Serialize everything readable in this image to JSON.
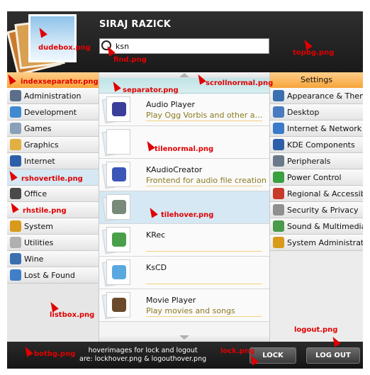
{
  "user": {
    "name": "SIRAJ RAZICK"
  },
  "search": {
    "value": "ksn",
    "icon": "magnifier-icon"
  },
  "categories": [
    {
      "label": "Administration",
      "color": "#5b6f8a"
    },
    {
      "label": "Development",
      "color": "#3f8ad0"
    },
    {
      "label": "Games",
      "color": "#8aa0b8"
    },
    {
      "label": "Graphics",
      "color": "#e0b040"
    },
    {
      "label": "Internet",
      "color": "#2d5fa8"
    },
    {
      "label": "",
      "color": "#d5e8f4"
    },
    {
      "label": "Office",
      "color": "#4a4a4a"
    },
    {
      "label": "",
      "color": "#e4e4e4"
    },
    {
      "label": "System",
      "color": "#d89a1a"
    },
    {
      "label": "Utilities",
      "color": "#b0b0b0"
    },
    {
      "label": "Wine",
      "color": "#3b6fb0"
    },
    {
      "label": "Lost & Found",
      "color": "#3f7fc8"
    }
  ],
  "apps": [
    {
      "name": "Audio Player",
      "desc": "Play Ogg Vorbis and other audio f...",
      "icon": "mms-icon",
      "color": "#3a3f9a"
    },
    {
      "name": "",
      "desc": "",
      "icon": "blank-tile",
      "color": "#ffffff"
    },
    {
      "name": "KAudioCreator",
      "desc": "Frontend for audio file creation",
      "icon": "cd-ripper-icon",
      "color": "#3b55b8"
    },
    {
      "name": "",
      "desc": "",
      "icon": "speaker-icon",
      "color": "#7a8a7a"
    },
    {
      "name": "KRec",
      "desc": "",
      "icon": "microphone-icon",
      "color": "#4aa04a"
    },
    {
      "name": "KsCD",
      "desc": "",
      "icon": "cd-player-icon",
      "color": "#5aa8e0"
    },
    {
      "name": "Movie Player",
      "desc": "Play movies and songs",
      "icon": "film-icon",
      "color": "#6a4a2a"
    }
  ],
  "settings": {
    "header": "Settings",
    "items": [
      {
        "label": "Appearance & Them.",
        "color": "#3a6fb0"
      },
      {
        "label": "Desktop",
        "color": "#4a7ac0"
      },
      {
        "label": "Internet & Network",
        "color": "#3a7ac8"
      },
      {
        "label": "KDE Components",
        "color": "#2d5fa8"
      },
      {
        "label": "Peripherals",
        "color": "#6a7a8a"
      },
      {
        "label": "Power Control",
        "color": "#3aa040"
      },
      {
        "label": "Regional & Accessibil.",
        "color": "#c83a2a"
      },
      {
        "label": "Security & Privacy",
        "color": "#909090"
      },
      {
        "label": "Sound & Multimedia",
        "color": "#4a9a4a"
      },
      {
        "label": "System Administratio.",
        "color": "#d89a1a"
      }
    ]
  },
  "bottom": {
    "note_line1": "hoverimages for lock and logout",
    "note_line2": "are: lockhover.png & logouthover.png",
    "lock_label": "LOCK",
    "logout_label": "LOG OUT"
  },
  "annotations": {
    "dudebox": "dudebox.png",
    "find": "find.png",
    "topbg": "topbg.png",
    "indexseparator": "indexseparator.png",
    "scrollnormal": "scrollnormal.png",
    "separator": "separator.png",
    "tilenormal": "tilenormal.png",
    "rshovertile": "rshovertile.png",
    "rhstile": "rhstile.png",
    "tilehover": "tilehover.png",
    "listbox": "listbox.png",
    "logout": "logout.png",
    "botbg": "botbg.png",
    "lock": "lock.png"
  },
  "colors": {
    "accent_orange": "#f7a43a",
    "hover_blue": "#d5e8f4",
    "annotation_red": "#e00000"
  }
}
